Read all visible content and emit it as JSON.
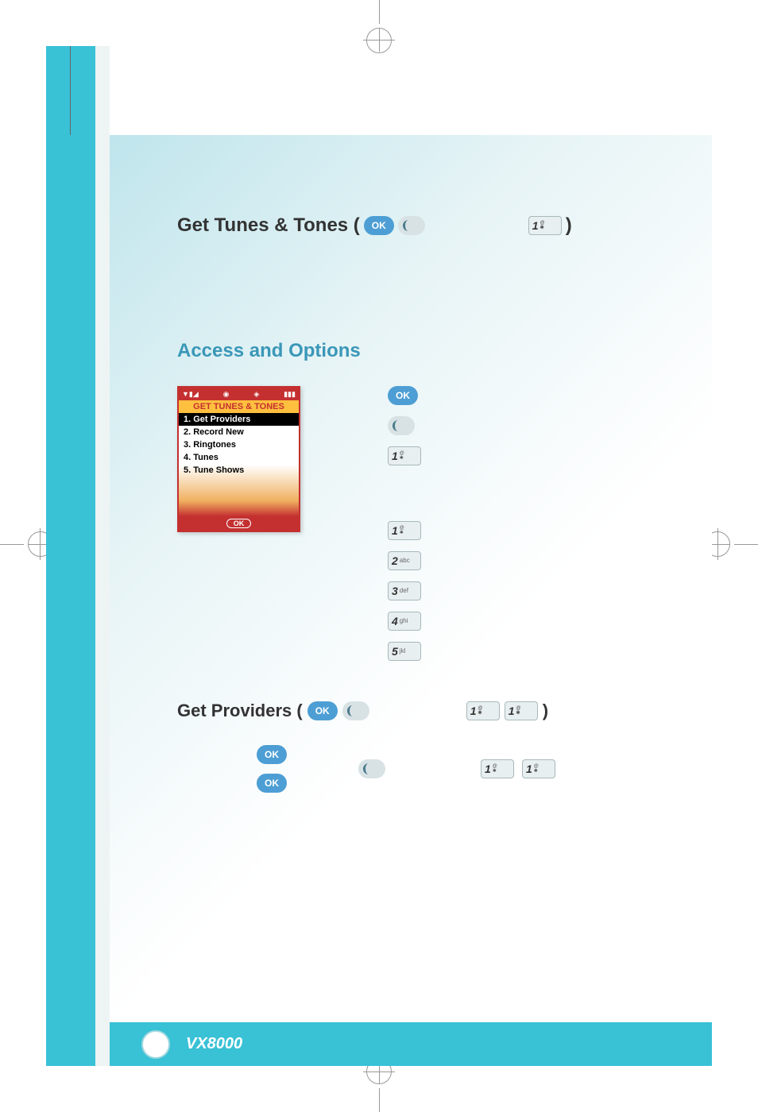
{
  "heading1_prefix": "Get Tunes & Tones (",
  "heading1_suffix": " )",
  "ok_label": "OK",
  "heading2": "Access and Options",
  "phone_screen": {
    "title": "GET TUNES & TONES",
    "items": [
      "1. Get Providers",
      "2. Record New",
      "3. Ringtones",
      "4. Tunes",
      "5. Tune Shows"
    ],
    "softkey": "OK"
  },
  "keys": {
    "k1": {
      "num": "1",
      "sub": ""
    },
    "k2": {
      "num": "2",
      "sub": "abc"
    },
    "k3": {
      "num": "3",
      "sub": "def"
    },
    "k4": {
      "num": "4",
      "sub": "ghi"
    },
    "k5": {
      "num": "5",
      "sub": "jkl"
    }
  },
  "sub_heading_prefix": "Get Providers (",
  "sub_heading_suffix": " )",
  "footer_model": "VX8000",
  "status_icons": {
    "signal": "▼▮◢",
    "camera": "◉",
    "diamond": "◈",
    "battery": "▮▮▮"
  }
}
